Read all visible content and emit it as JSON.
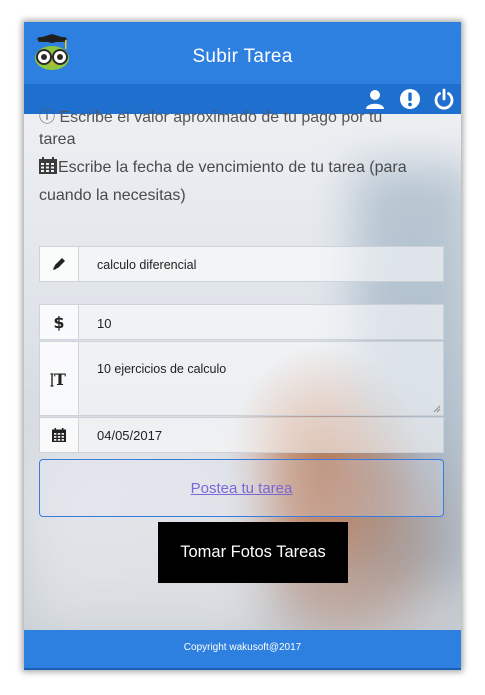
{
  "header": {
    "title": "Subir Tarea",
    "logo_icon": "owl-graduate-logo"
  },
  "toolbar": {
    "icons": [
      "user-icon",
      "info-icon",
      "power-icon"
    ]
  },
  "intro": {
    "cut_line": "ⓘ Escribe el valor aproximado de tu pago por tu",
    "line1": "tarea",
    "line2": "Escribe la fecha de vencimiento de tu tarea (para cuando la necesitas)"
  },
  "form": {
    "subject": {
      "value": "calculo diferencial",
      "icon": "pencil-icon"
    },
    "price": {
      "value": "10",
      "icon": "dollar-icon"
    },
    "description": {
      "value": "10 ejercicios de calculo",
      "icon": "text-height-icon"
    },
    "due_date": {
      "value": "04/05/2017",
      "icon": "calendar-icon"
    }
  },
  "actions": {
    "post_label": "Postea tu tarea",
    "photo_label": "Tomar Fotos Tareas"
  },
  "footer": {
    "copyright": "Copyright wakusoft@2017"
  },
  "colors": {
    "primary": "#2d7fe0",
    "toolbar": "#1f6fcf",
    "link": "#7a68d8"
  }
}
